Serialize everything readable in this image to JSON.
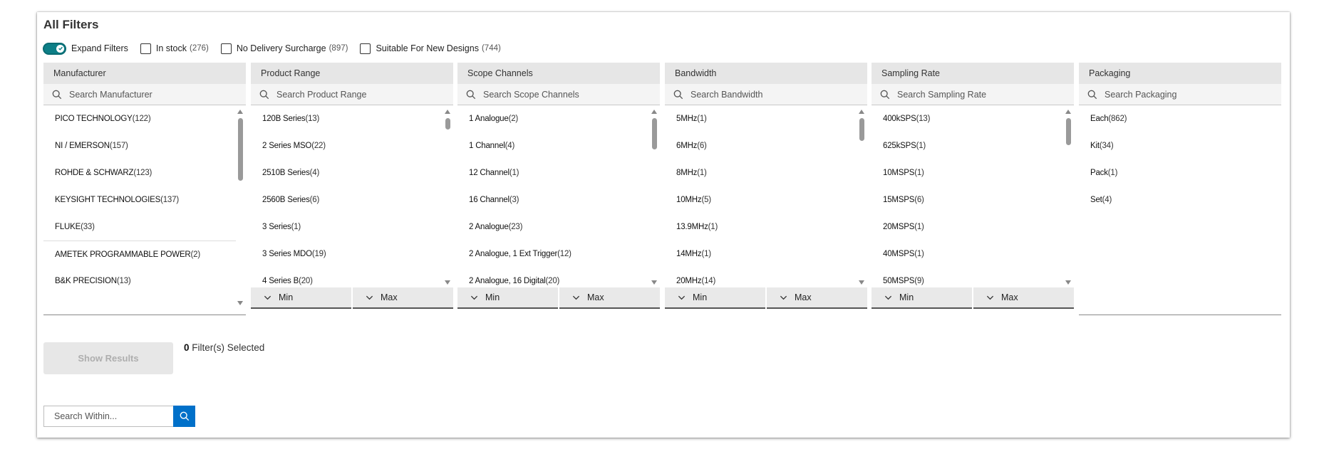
{
  "title": "All Filters",
  "toolbar": {
    "expand_label": "Expand Filters",
    "in_stock_label": "In stock",
    "in_stock_count": "(276)",
    "no_surcharge_label": "No Delivery Surcharge",
    "no_surcharge_count": "(897)",
    "new_designs_label": "Suitable For New Designs",
    "new_designs_count": "(744)"
  },
  "columns": [
    {
      "header": "Manufacturer",
      "search_placeholder": "Search Manufacturer",
      "items": [
        {
          "name": "PICO TECHNOLOGY",
          "count": "(122)"
        },
        {
          "name": "NI / EMERSON",
          "count": "(157)"
        },
        {
          "name": "ROHDE & SCHWARZ",
          "count": "(123)"
        },
        {
          "name": "KEYSIGHT TECHNOLOGIES",
          "count": "(137)"
        },
        {
          "name": "FLUKE",
          "count": "(33)"
        },
        {
          "name": "AMETEK PROGRAMMABLE POWER",
          "count": "(2)"
        },
        {
          "name": "B&K PRECISION",
          "count": "(13)"
        }
      ]
    },
    {
      "header": "Product Range",
      "search_placeholder": "Search Product Range",
      "items": [
        {
          "name": "120B Series",
          "count": "(13)"
        },
        {
          "name": "2 Series MSO",
          "count": "(22)"
        },
        {
          "name": "2510B Series",
          "count": "(4)"
        },
        {
          "name": "2560B Series",
          "count": "(6)"
        },
        {
          "name": "3 Series",
          "count": "(1)"
        },
        {
          "name": "3 Series MDO",
          "count": "(19)"
        },
        {
          "name": "4 Series B",
          "count": "(20)"
        }
      ],
      "min_label": "Min",
      "max_label": "Max"
    },
    {
      "header": "Scope Channels",
      "search_placeholder": "Search Scope Channels",
      "items": [
        {
          "name": "1 Analogue",
          "count": "(2)"
        },
        {
          "name": "1 Channel",
          "count": "(4)"
        },
        {
          "name": "12 Channel",
          "count": "(1)"
        },
        {
          "name": "16 Channel",
          "count": "(3)"
        },
        {
          "name": "2 Analogue",
          "count": "(23)"
        },
        {
          "name": "2 Analogue, 1 Ext Trigger",
          "count": "(12)"
        },
        {
          "name": "2 Analogue, 16 Digital",
          "count": "(20)"
        }
      ],
      "min_label": "Min",
      "max_label": "Max"
    },
    {
      "header": "Bandwidth",
      "search_placeholder": "Search Bandwidth",
      "items": [
        {
          "name": "5MHz",
          "count": "(1)"
        },
        {
          "name": "6MHz",
          "count": "(6)"
        },
        {
          "name": "8MHz",
          "count": "(1)"
        },
        {
          "name": "10MHz",
          "count": "(5)"
        },
        {
          "name": "13.9MHz",
          "count": "(1)"
        },
        {
          "name": "14MHz",
          "count": "(1)"
        },
        {
          "name": "20MHz",
          "count": "(14)"
        }
      ],
      "min_label": "Min",
      "max_label": "Max"
    },
    {
      "header": "Sampling Rate",
      "search_placeholder": "Search Sampling Rate",
      "items": [
        {
          "name": "400kSPS",
          "count": "(13)"
        },
        {
          "name": "625kSPS",
          "count": "(1)"
        },
        {
          "name": "10MSPS",
          "count": "(1)"
        },
        {
          "name": "15MSPS",
          "count": "(6)"
        },
        {
          "name": "20MSPS",
          "count": "(1)"
        },
        {
          "name": "40MSPS",
          "count": "(1)"
        },
        {
          "name": "50MSPS",
          "count": "(9)"
        }
      ],
      "min_label": "Min",
      "max_label": "Max"
    },
    {
      "header": "Packaging",
      "search_placeholder": "Search Packaging",
      "items": [
        {
          "name": "Each",
          "count": "(862)"
        },
        {
          "name": "Kit",
          "count": "(34)"
        },
        {
          "name": "Pack",
          "count": "(1)"
        },
        {
          "name": "Set",
          "count": "(4)"
        }
      ]
    }
  ],
  "show_results_label": "Show Results",
  "selected": {
    "count": "0",
    "label": "Filter(s) Selected"
  },
  "search_within": {
    "placeholder": "Search Within..."
  },
  "icons": {
    "search": "search-icon",
    "chevron": "chevron-down-icon",
    "check": "check-icon"
  },
  "colors": {
    "toggle_on": "#0d7f87",
    "search_button": "#0070c9",
    "header_bg": "#e6e6e6"
  }
}
